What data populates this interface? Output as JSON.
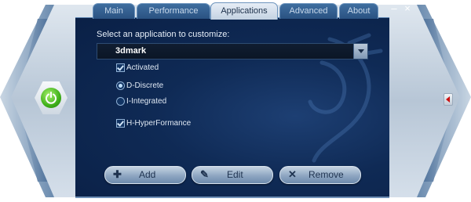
{
  "tabs": [
    {
      "label": "Main"
    },
    {
      "label": "Performance"
    },
    {
      "label": "Applications"
    },
    {
      "label": "Advanced"
    },
    {
      "label": "About"
    }
  ],
  "active_tab": "Applications",
  "window": {
    "minimize_glyph": "–",
    "close_glyph": "×"
  },
  "content": {
    "prompt": "Select an application to customize:",
    "selected_app": "3dmark",
    "activated_label": "Activated",
    "activated_checked": true,
    "radio_discrete_label": "D-Discrete",
    "radio_discrete_selected": true,
    "radio_integrated_label": "I-Integrated",
    "radio_integrated_selected": false,
    "hyperformance_label": "H-HyperFormance",
    "hyperformance_checked": true
  },
  "buttons": {
    "add": "Add",
    "edit": "Edit",
    "remove": "Remove"
  },
  "icons": {
    "power": "power-icon",
    "add": "plus-icon",
    "edit": "pencil-icon",
    "remove": "x-icon",
    "side": "arrow-left-icon"
  },
  "colors": {
    "panel": "#0f2a55",
    "power_green": "#3fb01a",
    "side_arrow": "#cc1010"
  }
}
